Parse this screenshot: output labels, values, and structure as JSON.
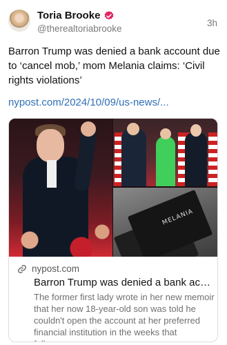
{
  "author": {
    "display_name": "Toria Brooke",
    "handle": "@therealtoriabrooke",
    "timestamp": "3h",
    "verified_icon": "verified-badge-icon",
    "verified_color": "#e0245e"
  },
  "post": {
    "text": "Barron Trump was denied a bank account due to ‘cancel mob,’ mom Melania claims: ‘Civil rights violations’",
    "link_text": "nypost.com/2024/10/09/us-news/...",
    "link_color": "#2f6fb6"
  },
  "link_card": {
    "image_text": "MELANIA",
    "domain": "nypost.com",
    "link_icon": "link-icon",
    "title": "Barron Trump was denied a bank acc...",
    "description": "The former first lady wrote in her new memoir that her now 18-year-old son was told he couldn't open the account at her preferred financial institution in the weeks that followe..."
  }
}
